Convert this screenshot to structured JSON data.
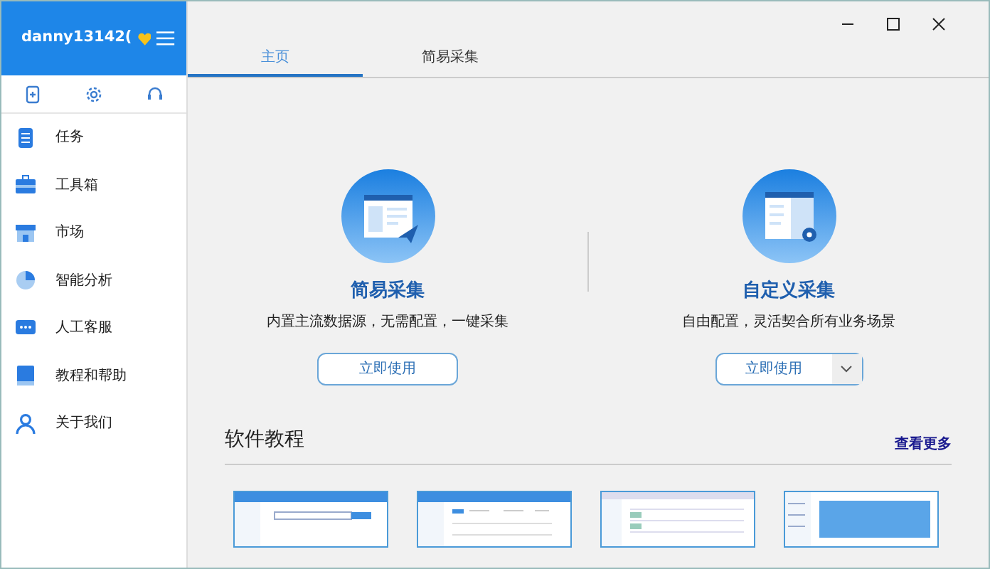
{
  "sidebar": {
    "username": "danny13142(",
    "vip": true,
    "tool_icons": [
      {
        "kind": "phone"
      },
      {
        "kind": "gear"
      },
      {
        "kind": "headset"
      }
    ],
    "items": [
      {
        "label": "任务",
        "kind": "task",
        "selected": false
      },
      {
        "label": "工具箱",
        "kind": "toolbox",
        "selected": false
      },
      {
        "label": "市场",
        "kind": "market",
        "selected": false
      },
      {
        "label": "智能分析",
        "kind": "chart",
        "selected": false
      },
      {
        "label": "人工客服",
        "kind": "chat",
        "selected": false
      },
      {
        "label": "教程和帮助",
        "kind": "book",
        "selected": false
      },
      {
        "label": "关于我们",
        "kind": "user",
        "selected": false
      }
    ]
  },
  "tabs": [
    {
      "label": "主页",
      "selected": true
    },
    {
      "label": "简易采集",
      "selected": false
    }
  ],
  "modes": [
    {
      "title": "简易采集",
      "description": "内置主流数据源，无需配置，一键采集",
      "button": "立即使用",
      "kind": "simple",
      "dropdown": false
    },
    {
      "title": "自定义采集",
      "description": "自由配置，灵活契合所有业务场景",
      "button": "立即使用",
      "kind": "custom",
      "dropdown": true
    }
  ],
  "tutorials": {
    "title": "软件教程",
    "more_link": "查看更多",
    "thumbnails": [
      {
        "kind": "search"
      },
      {
        "kind": "form"
      },
      {
        "kind": "list"
      },
      {
        "kind": "banner"
      }
    ]
  }
}
